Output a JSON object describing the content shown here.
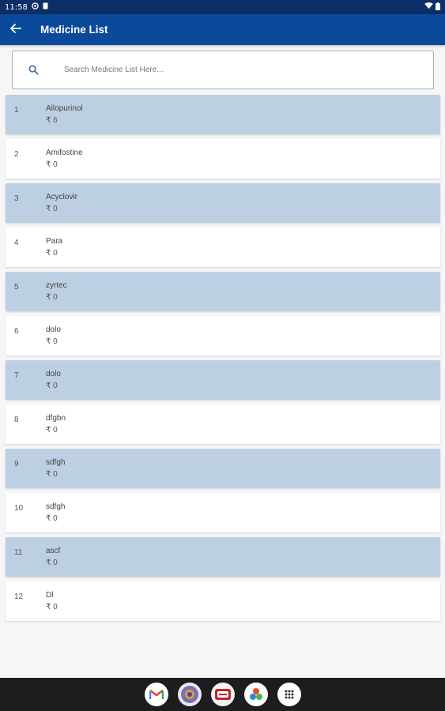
{
  "status_bar": {
    "time": "11:58"
  },
  "app_bar": {
    "title": "Medicine List",
    "back_icon": "arrow-left-icon"
  },
  "search": {
    "placeholder": "Search Medicine List Here..."
  },
  "medicines": [
    {
      "index": "1",
      "name": "Allopurinol",
      "price": "₹ 6"
    },
    {
      "index": "2",
      "name": "Amifostine",
      "price": "₹ 0"
    },
    {
      "index": "3",
      "name": "Acyclovir",
      "price": "₹ 0"
    },
    {
      "index": "4",
      "name": "Para",
      "price": "₹ 0"
    },
    {
      "index": "5",
      "name": "zyrtec",
      "price": "₹ 0"
    },
    {
      "index": "6",
      "name": "dolo",
      "price": "₹ 0"
    },
    {
      "index": "7",
      "name": "dolo",
      "price": "₹ 0"
    },
    {
      "index": "8",
      "name": "dfgbn",
      "price": "₹ 0"
    },
    {
      "index": "9",
      "name": "sdfgh",
      "price": "₹ 0"
    },
    {
      "index": "10",
      "name": "sdfgh",
      "price": "₹ 0"
    },
    {
      "index": "11",
      "name": "ascf",
      "price": "₹ 0"
    },
    {
      "index": "12",
      "name": "Dl",
      "price": "₹ 0"
    }
  ],
  "colors": {
    "app_bar": "#0b4a9a",
    "status_bar": "#0d2f68",
    "row_shaded": "#bdcfe3",
    "row_plain": "#ffffff"
  },
  "dock_apps": [
    "gmail-icon",
    "app-icon-2",
    "app-icon-3",
    "app-icon-4",
    "app-drawer-icon"
  ]
}
